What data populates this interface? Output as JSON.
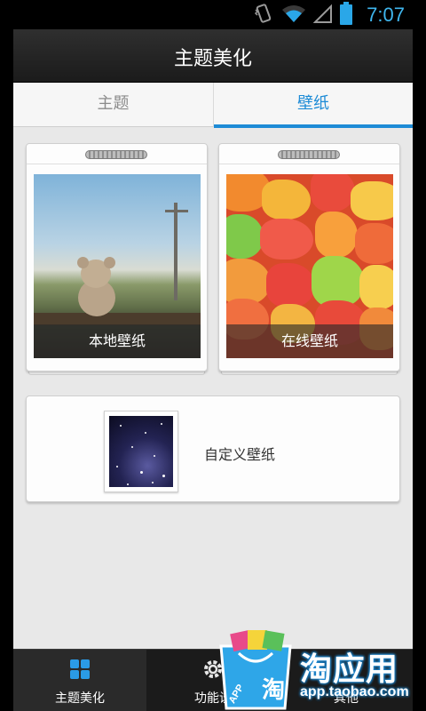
{
  "status_bar": {
    "time": "7:07",
    "icons": [
      "vibrate-icon",
      "wifi-icon",
      "signal-icon",
      "battery-icon"
    ],
    "accent_color": "#3fb6ee"
  },
  "header": {
    "title": "主题美化"
  },
  "tabs": [
    {
      "label": "主题",
      "selected": false
    },
    {
      "label": "壁纸",
      "selected": true
    }
  ],
  "tab_accent_color": "#1d8bd6",
  "wallpaper_sources": [
    {
      "label": "本地壁纸",
      "image": "teddy-bear-photo"
    },
    {
      "label": "在线壁纸",
      "image": "candy-photo"
    }
  ],
  "custom_wallpaper": {
    "label": "自定义壁纸",
    "image": "starry-sky-thumbnail"
  },
  "bottom_nav": [
    {
      "label": "主题美化",
      "icon": "grid-icon",
      "selected": true
    },
    {
      "label": "功能设",
      "icon": "gear-icon",
      "selected": false
    },
    {
      "label": "其他",
      "icon": "more-icon",
      "selected": false
    }
  ],
  "watermark": {
    "title": "淘应用",
    "url": "app.taobao.com",
    "bag_text": "淘",
    "bag_tag": "APP"
  }
}
